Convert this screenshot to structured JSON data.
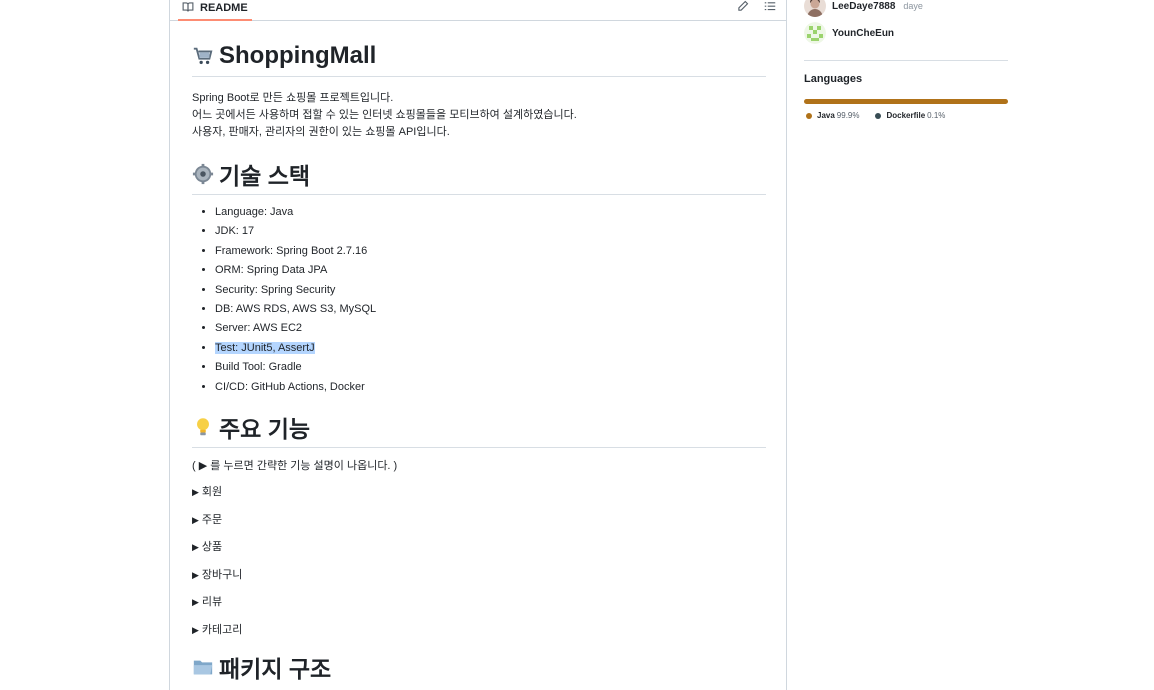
{
  "readme": {
    "tab_label": "README",
    "title_emoji": "cart-icon",
    "title": "ShoppingMall",
    "intro": [
      "Spring Boot로 만든 쇼핑몰 프로젝트입니다.",
      "어느 곳에서든 사용하며 접할 수 있는 인터넷 쇼핑몰들을 모티브하여 설계하였습니다.",
      "사용자, 판매자, 관리자의 권한이 있는 쇼핑몰 API입니다."
    ],
    "tech_heading": "기술 스택",
    "tech_items": [
      "Language: Java",
      "JDK: 17",
      "Framework: Spring Boot 2.7.16",
      "ORM: Spring Data JPA",
      "Security: Spring Security",
      "DB: AWS RDS, AWS S3, MySQL",
      "Server: AWS EC2",
      "Test: JUnit5, AssertJ",
      "Build Tool: Gradle",
      "CI/CD: GitHub Actions, Docker"
    ],
    "features_heading": "주요 기능",
    "features_hint": "( ▶ 를 누르면 간략한 기능 설명이 나옵니다. )",
    "feature_toggles": [
      "회원",
      "주문",
      "상품",
      "장바구니",
      "리뷰",
      "카테고리"
    ],
    "package_heading": "패키지 구조"
  },
  "sidebar": {
    "contributors": [
      {
        "name": "LeeDaye7888",
        "login": "daye"
      },
      {
        "name": "YounCheEun",
        "login": ""
      }
    ],
    "languages_title": "Languages",
    "languages": [
      {
        "name": "Java",
        "percent": "99.9%",
        "value": 99.9,
        "color": "#b07219"
      },
      {
        "name": "Dockerfile",
        "percent": "0.1%",
        "value": 0.1,
        "color": "#384d54"
      }
    ]
  }
}
